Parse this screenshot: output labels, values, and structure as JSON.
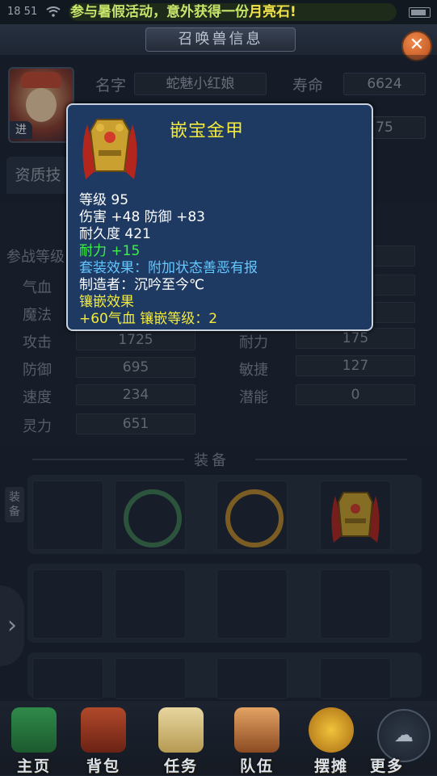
{
  "status": {
    "time": "18 51",
    "marquee_prefix": "参与暑假活动，意外获得一份",
    "marquee_item": "月亮石",
    "marquee_suffix": "!"
  },
  "window": {
    "title": "召唤兽信息",
    "close": "✕"
  },
  "pet": {
    "name_label": "名字",
    "name": "蛇魅小红娘",
    "life_label": "寿命",
    "life": "6624",
    "row2_value": "75",
    "evolve": "进",
    "tab_partial": "资质技"
  },
  "stats": {
    "left": [
      {
        "label": "参战等级",
        "value": ""
      },
      {
        "label": "气血",
        "value": ""
      },
      {
        "label": "魔法",
        "value": ""
      },
      {
        "label": "攻击",
        "value": "1725"
      },
      {
        "label": "防御",
        "value": "695"
      },
      {
        "label": "速度",
        "value": "234"
      },
      {
        "label": "灵力",
        "value": "651"
      }
    ],
    "right": [
      {
        "label": "耐力",
        "value": "175"
      },
      {
        "label": "敏捷",
        "value": "127"
      },
      {
        "label": "潜能",
        "value": "0"
      }
    ]
  },
  "equipment": {
    "title": "装备",
    "side_label": "装备"
  },
  "nav": {
    "items": [
      "主页",
      "背包",
      "任务",
      "队伍",
      "摆摊"
    ],
    "more": "更多"
  },
  "tooltip": {
    "name": "嵌宝金甲",
    "level_label": "等级",
    "level": "95",
    "damage": "伤害 +48  防御  +83",
    "durability": "耐久度  421",
    "stamina": "耐力  +15",
    "set_effect": "套装效果：附加状态善恶有报",
    "maker": "制造者：沉吟至今℃",
    "inlay_title": "镶嵌效果",
    "inlay_detail": "+60气血  镶嵌等级：2"
  },
  "colors": {
    "tooltip_bg": "#1e3a63",
    "item_name": "#f3ea3b",
    "green": "#3ff04a",
    "blue": "#63c7ff"
  }
}
